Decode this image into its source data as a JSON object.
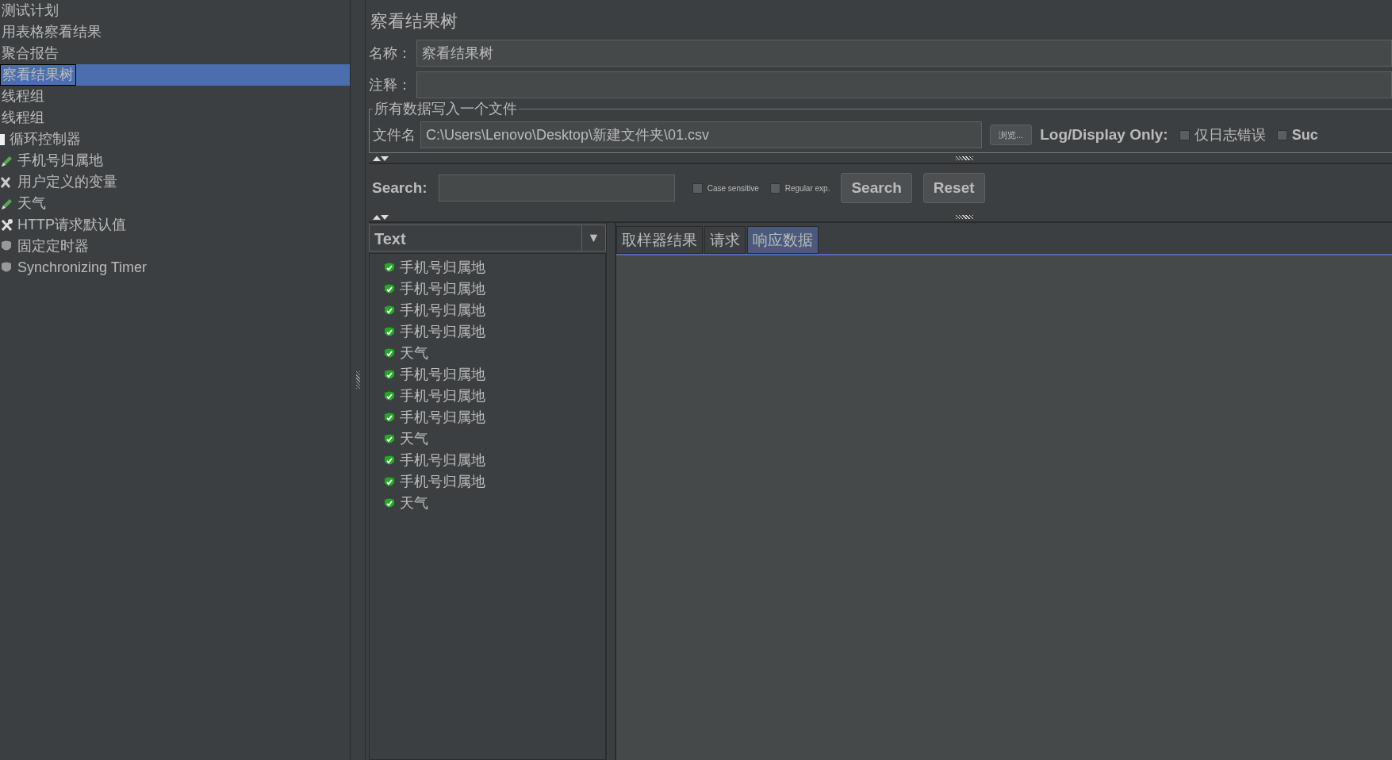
{
  "tree": [
    {
      "label": "测试计划",
      "kind": "none",
      "selected": false
    },
    {
      "label": "用表格察看结果",
      "kind": "none",
      "selected": false
    },
    {
      "label": "聚合报告",
      "kind": "none",
      "selected": false
    },
    {
      "label": "察看结果树",
      "kind": "none",
      "selected": true
    },
    {
      "label": "线程组",
      "kind": "none",
      "selected": false
    },
    {
      "label": "线程组",
      "kind": "none",
      "selected": false
    },
    {
      "label": "循环控制器",
      "kind": "loop",
      "selected": false
    },
    {
      "label": "手机号归属地",
      "kind": "sampler",
      "selected": false
    },
    {
      "label": "用户定义的变量",
      "kind": "config",
      "selected": false
    },
    {
      "label": "天气",
      "kind": "sampler",
      "selected": false
    },
    {
      "label": "HTTP请求默认值",
      "kind": "tool",
      "selected": false
    },
    {
      "label": "固定定时器",
      "kind": "timer",
      "selected": false
    },
    {
      "label": "Synchronizing Timer",
      "kind": "timer",
      "selected": false
    }
  ],
  "panel": {
    "title": "察看结果树",
    "name_label": "名称：",
    "name_value": "察看结果树",
    "comment_label": "注释：",
    "file_group": {
      "legend": "所有数据写入一个文件",
      "file_label": "文件名",
      "file_value": "C:\\Users\\Lenovo\\Desktop\\新建文件夹\\01.csv",
      "browse": "浏览...",
      "log_label": "Log/Display Only:",
      "options": [
        {
          "label": "仅日志错误",
          "checked": false
        },
        {
          "label": "Suc",
          "checked": false
        }
      ]
    }
  },
  "search": {
    "label": "Search:",
    "options": [
      {
        "label": "Case sensitive",
        "checked": false
      },
      {
        "label": "Regular exp.",
        "checked": false
      }
    ],
    "buttons": [
      "Search",
      "Reset"
    ]
  },
  "renderer": {
    "value": "Text",
    "arrow": "▼"
  },
  "results": [
    {
      "label": "手机号归属地",
      "success": true
    },
    {
      "label": "手机号归属地",
      "success": true
    },
    {
      "label": "手机号归属地",
      "success": true
    },
    {
      "label": "手机号归属地",
      "success": true
    },
    {
      "label": "天气",
      "success": true
    },
    {
      "label": "手机号归属地",
      "success": true
    },
    {
      "label": "手机号归属地",
      "success": true
    },
    {
      "label": "手机号归属地",
      "success": true
    },
    {
      "label": "天气",
      "success": true
    },
    {
      "label": "手机号归属地",
      "success": true
    },
    {
      "label": "手机号归属地",
      "success": true
    },
    {
      "label": "天气",
      "success": true
    }
  ],
  "tabs": [
    {
      "label": "取样器结果",
      "selected": false
    },
    {
      "label": "请求",
      "selected": false
    },
    {
      "label": "响应数据",
      "selected": true
    }
  ]
}
